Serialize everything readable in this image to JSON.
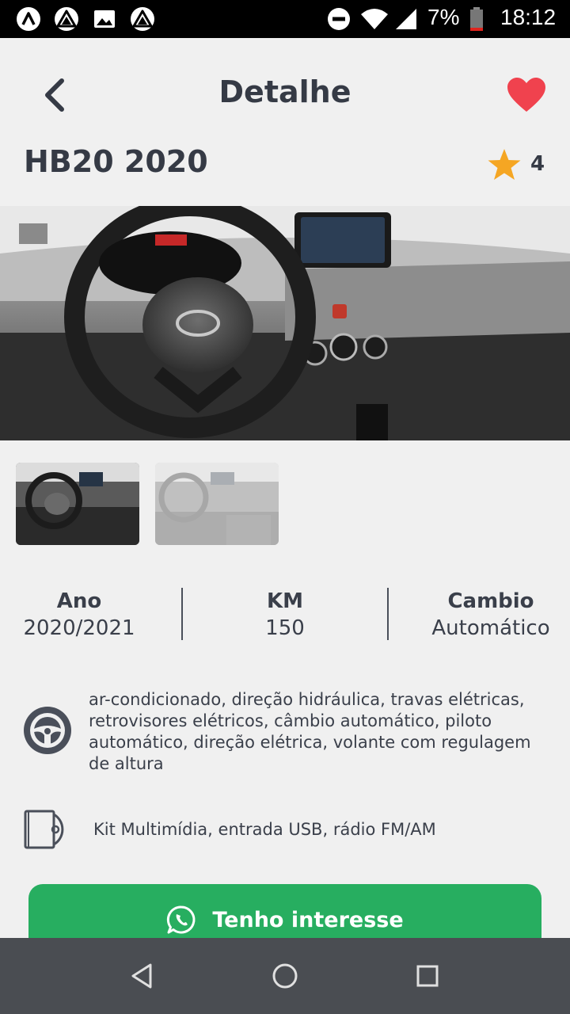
{
  "status_bar": {
    "battery": "7%",
    "time": "18:12",
    "left_icons": [
      "app-a-icon",
      "app-triangle-icon",
      "image-icon",
      "app-triangle-icon"
    ],
    "right_icons": [
      "dnd-icon",
      "wifi-icon",
      "signal-icon",
      "battery-icon"
    ]
  },
  "header": {
    "title": "Detalhe",
    "back_icon": "back-chevron-icon",
    "favorite_icon": "heart-icon",
    "favorite_color": "#f0424e"
  },
  "car": {
    "title": "HB20 2020",
    "rating": "4",
    "star_color": "#f5a623"
  },
  "gallery": {
    "main_image": "car-interior-photo",
    "thumbnails": [
      "car-interior-thumb-1",
      "car-interior-thumb-2"
    ]
  },
  "specs": [
    {
      "label": "Ano",
      "value": "2020/2021"
    },
    {
      "label": "KM",
      "value": "150"
    },
    {
      "label": "Cambio",
      "value": "Automático"
    }
  ],
  "features": [
    {
      "icon": "steering-wheel-icon",
      "text": "ar-condicionado, direção hidráulica, travas elétricas, retrovisores elétricos, câmbio automático, piloto automático, direção elétrica, volante com regulagem de altura"
    },
    {
      "icon": "cd-case-icon",
      "text": "Kit Multimídia, entrada USB, rádio FM/AM"
    }
  ],
  "cta": {
    "label": "Tenho interesse",
    "icon": "whatsapp-icon",
    "color": "#27ae60"
  },
  "nav_bar": {
    "buttons": [
      "back-triangle-icon",
      "home-circle-icon",
      "recents-square-icon"
    ]
  }
}
